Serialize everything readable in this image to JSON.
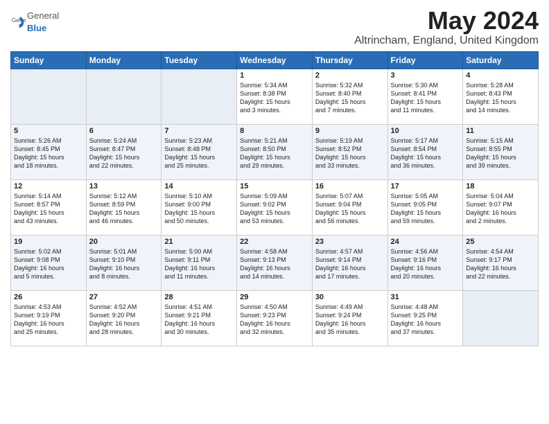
{
  "logo": {
    "general": "General",
    "blue": "Blue"
  },
  "title": "May 2024",
  "subtitle": "Altrincham, England, United Kingdom",
  "headers": [
    "Sunday",
    "Monday",
    "Tuesday",
    "Wednesday",
    "Thursday",
    "Friday",
    "Saturday"
  ],
  "weeks": [
    [
      {
        "date": "",
        "info": ""
      },
      {
        "date": "",
        "info": ""
      },
      {
        "date": "",
        "info": ""
      },
      {
        "date": "1",
        "info": "Sunrise: 5:34 AM\nSunset: 8:38 PM\nDaylight: 15 hours\nand 3 minutes."
      },
      {
        "date": "2",
        "info": "Sunrise: 5:32 AM\nSunset: 8:40 PM\nDaylight: 15 hours\nand 7 minutes."
      },
      {
        "date": "3",
        "info": "Sunrise: 5:30 AM\nSunset: 8:41 PM\nDaylight: 15 hours\nand 11 minutes."
      },
      {
        "date": "4",
        "info": "Sunrise: 5:28 AM\nSunset: 8:43 PM\nDaylight: 15 hours\nand 14 minutes."
      }
    ],
    [
      {
        "date": "5",
        "info": "Sunrise: 5:26 AM\nSunset: 8:45 PM\nDaylight: 15 hours\nand 18 minutes."
      },
      {
        "date": "6",
        "info": "Sunrise: 5:24 AM\nSunset: 8:47 PM\nDaylight: 15 hours\nand 22 minutes."
      },
      {
        "date": "7",
        "info": "Sunrise: 5:23 AM\nSunset: 8:48 PM\nDaylight: 15 hours\nand 25 minutes."
      },
      {
        "date": "8",
        "info": "Sunrise: 5:21 AM\nSunset: 8:50 PM\nDaylight: 15 hours\nand 29 minutes."
      },
      {
        "date": "9",
        "info": "Sunrise: 5:19 AM\nSunset: 8:52 PM\nDaylight: 15 hours\nand 33 minutes."
      },
      {
        "date": "10",
        "info": "Sunrise: 5:17 AM\nSunset: 8:54 PM\nDaylight: 15 hours\nand 36 minutes."
      },
      {
        "date": "11",
        "info": "Sunrise: 5:15 AM\nSunset: 8:55 PM\nDaylight: 15 hours\nand 39 minutes."
      }
    ],
    [
      {
        "date": "12",
        "info": "Sunrise: 5:14 AM\nSunset: 8:57 PM\nDaylight: 15 hours\nand 43 minutes."
      },
      {
        "date": "13",
        "info": "Sunrise: 5:12 AM\nSunset: 8:59 PM\nDaylight: 15 hours\nand 46 minutes."
      },
      {
        "date": "14",
        "info": "Sunrise: 5:10 AM\nSunset: 9:00 PM\nDaylight: 15 hours\nand 50 minutes."
      },
      {
        "date": "15",
        "info": "Sunrise: 5:09 AM\nSunset: 9:02 PM\nDaylight: 15 hours\nand 53 minutes."
      },
      {
        "date": "16",
        "info": "Sunrise: 5:07 AM\nSunset: 9:04 PM\nDaylight: 15 hours\nand 56 minutes."
      },
      {
        "date": "17",
        "info": "Sunrise: 5:05 AM\nSunset: 9:05 PM\nDaylight: 15 hours\nand 59 minutes."
      },
      {
        "date": "18",
        "info": "Sunrise: 5:04 AM\nSunset: 9:07 PM\nDaylight: 16 hours\nand 2 minutes."
      }
    ],
    [
      {
        "date": "19",
        "info": "Sunrise: 5:02 AM\nSunset: 9:08 PM\nDaylight: 16 hours\nand 5 minutes."
      },
      {
        "date": "20",
        "info": "Sunrise: 5:01 AM\nSunset: 9:10 PM\nDaylight: 16 hours\nand 8 minutes."
      },
      {
        "date": "21",
        "info": "Sunrise: 5:00 AM\nSunset: 9:11 PM\nDaylight: 16 hours\nand 11 minutes."
      },
      {
        "date": "22",
        "info": "Sunrise: 4:58 AM\nSunset: 9:13 PM\nDaylight: 16 hours\nand 14 minutes."
      },
      {
        "date": "23",
        "info": "Sunrise: 4:57 AM\nSunset: 9:14 PM\nDaylight: 16 hours\nand 17 minutes."
      },
      {
        "date": "24",
        "info": "Sunrise: 4:56 AM\nSunset: 9:16 PM\nDaylight: 16 hours\nand 20 minutes."
      },
      {
        "date": "25",
        "info": "Sunrise: 4:54 AM\nSunset: 9:17 PM\nDaylight: 16 hours\nand 22 minutes."
      }
    ],
    [
      {
        "date": "26",
        "info": "Sunrise: 4:53 AM\nSunset: 9:19 PM\nDaylight: 16 hours\nand 25 minutes."
      },
      {
        "date": "27",
        "info": "Sunrise: 4:52 AM\nSunset: 9:20 PM\nDaylight: 16 hours\nand 28 minutes."
      },
      {
        "date": "28",
        "info": "Sunrise: 4:51 AM\nSunset: 9:21 PM\nDaylight: 16 hours\nand 30 minutes."
      },
      {
        "date": "29",
        "info": "Sunrise: 4:50 AM\nSunset: 9:23 PM\nDaylight: 16 hours\nand 32 minutes."
      },
      {
        "date": "30",
        "info": "Sunrise: 4:49 AM\nSunset: 9:24 PM\nDaylight: 16 hours\nand 35 minutes."
      },
      {
        "date": "31",
        "info": "Sunrise: 4:48 AM\nSunset: 9:25 PM\nDaylight: 16 hours\nand 37 minutes."
      },
      {
        "date": "",
        "info": ""
      }
    ]
  ]
}
